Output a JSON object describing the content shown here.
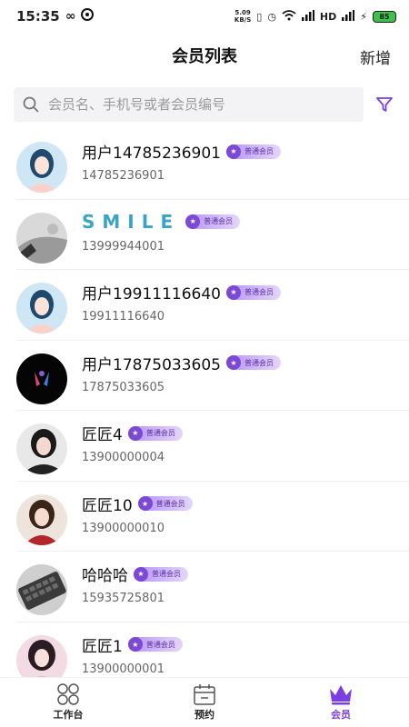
{
  "status_bar": {
    "time": "15:35",
    "net_speed_value": "5.09",
    "net_speed_unit": "KB/S",
    "battery": "85"
  },
  "header": {
    "title": "会员列表",
    "add_label": "新增"
  },
  "search": {
    "placeholder": "会员名、手机号或者会员编号"
  },
  "colors": {
    "accent": "#7b3fe0",
    "badge_star": "#7c49d6"
  },
  "members": [
    {
      "name": "用户14785236901",
      "phone": "14785236901",
      "level": "普通会员",
      "avatar": "girl-illustration"
    },
    {
      "name": "SMILE",
      "phone": "13999944001",
      "level": "普通会员",
      "avatar": "grey-photo"
    },
    {
      "name": "用户19911116640",
      "phone": "19911116640",
      "level": "普通会员",
      "avatar": "girl-illustration"
    },
    {
      "name": "用户17875033605",
      "phone": "17875033605",
      "level": "普通会员",
      "avatar": "dark-figure"
    },
    {
      "name": "匠匠4",
      "phone": "13900000004",
      "level": "普通会员",
      "avatar": "woman-photo"
    },
    {
      "name": "匠匠10",
      "phone": "13900000010",
      "level": "普通会员",
      "avatar": "woman-photo-red"
    },
    {
      "name": "哈哈哈",
      "phone": "15935725801",
      "level": "普通会员",
      "avatar": "keyboard-photo"
    },
    {
      "name": "匠匠1",
      "phone": "13900000001",
      "level": "普通会员",
      "avatar": "woman-photo-pink"
    }
  ],
  "bottom_nav": [
    {
      "label": "工作台",
      "icon": "grid-icon"
    },
    {
      "label": "预约",
      "icon": "calendar-icon"
    },
    {
      "label": "会员",
      "icon": "crown-icon",
      "active": true
    }
  ]
}
